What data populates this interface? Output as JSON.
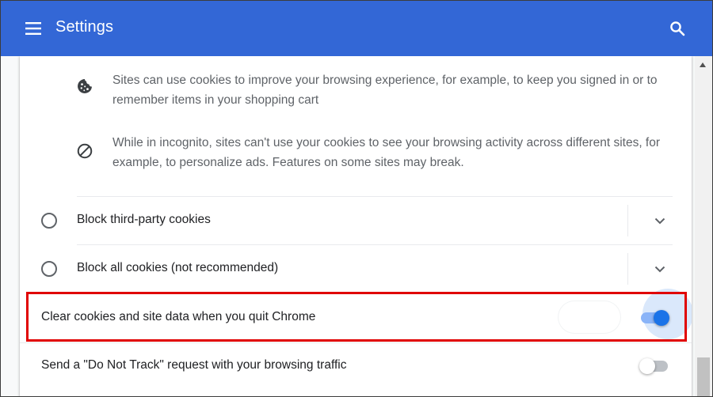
{
  "header": {
    "title": "Settings",
    "menu_icon": "hamburger-menu-icon",
    "search_icon": "search-icon",
    "bg_color": "#3367d6"
  },
  "info": [
    {
      "icon": "cookie-icon",
      "text": "Sites can use cookies to improve your browsing experience, for example, to keep you signed in or to remember items in your shopping cart"
    },
    {
      "icon": "block-icon",
      "text": "While in incognito, sites can't use your cookies to see your browsing activity across different sites, for example, to personalize ads. Features on some sites may break."
    }
  ],
  "radio_options": [
    {
      "label": "Block third-party cookies",
      "selected": false
    },
    {
      "label": "Block all cookies (not recommended)",
      "selected": false
    }
  ],
  "toggles": [
    {
      "label": "Clear cookies and site data when you quit Chrome",
      "on": true,
      "highlighted": true
    },
    {
      "label": "Send a \"Do Not Track\" request with your browsing traffic",
      "on": false,
      "highlighted": false
    }
  ],
  "colors": {
    "accent": "#1a73e8",
    "highlight_border": "#e00000"
  }
}
